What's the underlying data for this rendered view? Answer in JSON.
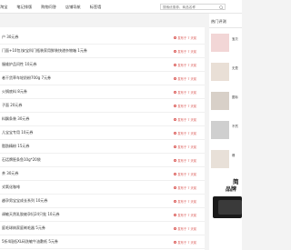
{
  "nav": {
    "items": [
      "淘宝",
      "笔记排版",
      "购物问答",
      "店铺导航",
      "标签墙"
    ]
  },
  "search": {
    "placeholder": "搜索优惠券、商品名称"
  },
  "list": {
    "rows": [
      {
        "text": "户 30元券",
        "time": "发布于 7 天前"
      },
      {
        "text": "门面+10包)安宝科门瓶装家用鲜装快递杂物箱 1元券",
        "time": "发布于 7 天前"
      },
      {
        "text": "服维护品问性 10元券",
        "time": "发布于 7 天前"
      },
      {
        "text": "者干货草车轮奶粉700g 7元券",
        "time": "发布于 7 天前"
      },
      {
        "text": "火锅底料 8元券",
        "time": "发布于 7 天前"
      },
      {
        "text": "子面 20元券",
        "time": "发布于 7 天前"
      },
      {
        "text": "料飘条装 30元券",
        "time": "发布于 7 天前"
      },
      {
        "text": "儿宝宝专用 10元券",
        "time": "发布于 7 天前"
      },
      {
        "text": "脂肪精粉 15元券",
        "time": "发布于 7 天前"
      },
      {
        "text": "石话牌胚条鱼10g*20袋",
        "time": "发布于 7 天前"
      },
      {
        "text": "茶 30元券",
        "time": "发布于 7 天前"
      },
      {
        "text": "式氧化咖啡",
        "time": "发布于 7 天前"
      },
      {
        "text": "越孕男宝宝成长系列 10元券",
        "time": "发布于 7 天前"
      },
      {
        "text": "调敏天然乳胶被孕妇24只批 10元券",
        "time": "发布于 7 天前"
      },
      {
        "text": "庭毛球纳家庭剃毛器 5元券",
        "time": "发布于 7 天前"
      },
      {
        "text": "5折4段低XL码洗敏牛油敷纸 5元券",
        "time": "发布于 7 天前"
      }
    ]
  },
  "sidebar": {
    "title": "热门评测",
    "items": [
      {
        "caption": "宝贝",
        "color": "#f2d6d6"
      },
      {
        "caption": "无是",
        "color": "#e9dfd6"
      },
      {
        "caption": "图标",
        "color": "#d8d0c8"
      },
      {
        "caption": "不然",
        "color": "#cfcfcf"
      },
      {
        "caption": "爆",
        "color": "#e8e0d8"
      }
    ]
  },
  "ad": {
    "line1": "简",
    "line2": "品牌"
  },
  "colors": {
    "accent": "#d9534f",
    "text": "#333333",
    "border": "#e6e6e6"
  }
}
